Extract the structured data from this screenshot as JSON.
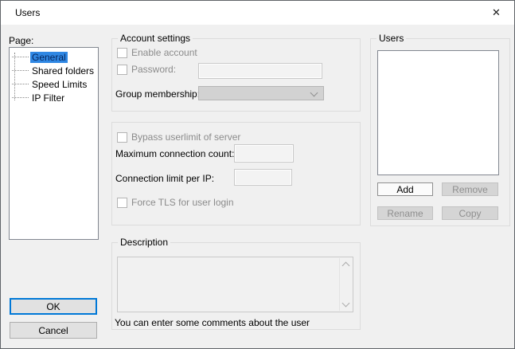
{
  "window": {
    "title": "Users",
    "close_glyph": "✕"
  },
  "page_panel": {
    "label": "Page:",
    "items": [
      {
        "label": "General",
        "selected": true
      },
      {
        "label": "Shared folders",
        "selected": false
      },
      {
        "label": "Speed Limits",
        "selected": false
      },
      {
        "label": "IP Filter",
        "selected": false
      }
    ]
  },
  "account_settings": {
    "title": "Account settings",
    "enable_account_label": "Enable account",
    "password_label": "Password:",
    "password_value": "",
    "group_membership_label": "Group membership:",
    "group_membership_value": ""
  },
  "limits": {
    "bypass_label": "Bypass userlimit of server",
    "max_connection_label": "Maximum connection count:",
    "max_connection_value": "",
    "conn_per_ip_label": "Connection limit per IP:",
    "conn_per_ip_value": "",
    "force_tls_label": "Force TLS for user login"
  },
  "description": {
    "title": "Description",
    "value": "",
    "hint": "You can enter some comments about the user"
  },
  "users": {
    "title": "Users",
    "list": [],
    "add_label": "Add",
    "remove_label": "Remove",
    "rename_label": "Rename",
    "copy_label": "Copy"
  },
  "dialog_buttons": {
    "ok_label": "OK",
    "cancel_label": "Cancel"
  },
  "colors": {
    "accent": "#0078d7",
    "tree_selection": "#2f87e3",
    "titlebar": "#ffffff",
    "dialog_bg": "#f0f0f0"
  }
}
